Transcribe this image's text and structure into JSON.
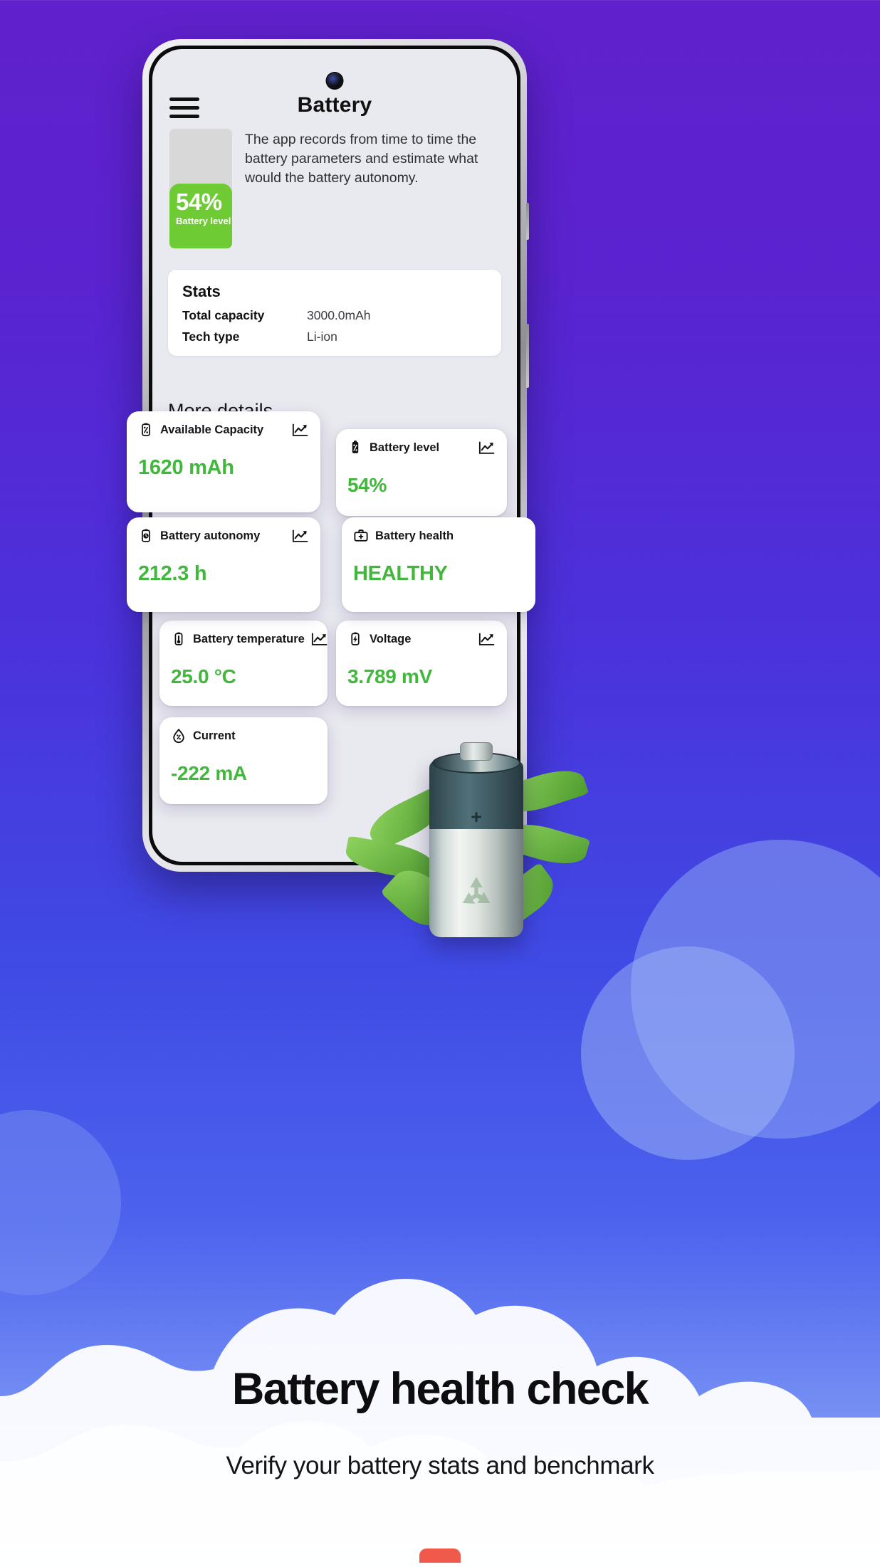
{
  "background": {
    "purple": "#6021CC",
    "blue": "#3F4EE0",
    "accent_green": "#41B83B",
    "level_green": "#6FCB34"
  },
  "app": {
    "menu_icon": "hamburger-menu-icon",
    "title": "Battery",
    "description": "The app records from time to time the battery parameters and estimate what would the battery autonomy.",
    "battery_widget": {
      "percent": "54%",
      "label": "Battery level",
      "fill_ratio": 54
    }
  },
  "stats": {
    "title": "Stats",
    "rows": [
      {
        "key": "Total capacity",
        "value": "3000.0mAh"
      },
      {
        "key": "Tech type",
        "value": "Li-ion"
      }
    ]
  },
  "more_details": {
    "title": "More details",
    "cards": [
      {
        "label": "Available Capacity",
        "value": "1620 mAh",
        "icon": "battery-percent-icon",
        "trend_icon": "trend-chart-icon"
      },
      {
        "label": "Battery level",
        "value": "54%",
        "icon": "battery-percent-icon",
        "trend_icon": "trend-chart-icon"
      },
      {
        "label": "Battery autonomy",
        "value": "212.3 h",
        "icon": "battery-clock-icon",
        "trend_icon": "trend-chart-icon"
      },
      {
        "label": "Battery health",
        "value": "HEALTHY",
        "icon": "medical-kit-icon",
        "trend_icon": ""
      },
      {
        "label": "Battery temperature",
        "value": "25.0 °C",
        "icon": "battery-thermometer-icon",
        "trend_icon": "trend-chart-icon"
      },
      {
        "label": "Voltage",
        "value": "3.789 mV",
        "icon": "battery-bolt-icon",
        "trend_icon": "trend-chart-icon"
      },
      {
        "label": "Current",
        "value": "-222 mA",
        "icon": "water-drop-percent-icon",
        "trend_icon": ""
      }
    ]
  },
  "illustration": {
    "battery_cell": "alkaline-battery-cell",
    "polarity": "+",
    "symbol": "recycle-icon",
    "foliage": "green-leaves"
  },
  "promo": {
    "headline": "Battery health check",
    "subhead": "Verify your battery stats and benchmark"
  }
}
